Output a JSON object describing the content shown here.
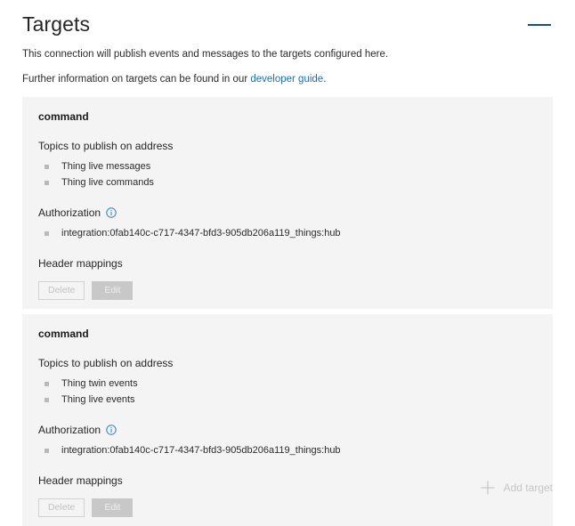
{
  "header": {
    "title": "Targets",
    "collapse_icon": "minus-icon"
  },
  "intro": {
    "line1": "This connection will publish events and messages to the targets configured here.",
    "line2_prefix": "Further information on targets can be found in our ",
    "link_text": "developer guide",
    "line2_suffix": "."
  },
  "labels": {
    "topics": "Topics to publish on address",
    "authorization": "Authorization",
    "header_mappings": "Header mappings",
    "info_icon": "info-icon",
    "delete": "Delete",
    "edit": "Edit"
  },
  "targets": [
    {
      "name": "command",
      "topics": [
        "Thing live messages",
        "Thing live commands"
      ],
      "authorization": [
        "integration:0fab140c-c717-4347-bfd3-905db206a119_things:hub"
      ]
    },
    {
      "name": "command",
      "topics": [
        "Thing twin events",
        "Thing live events"
      ],
      "authorization": [
        "integration:0fab140c-c717-4347-bfd3-905db206a119_things:hub"
      ]
    }
  ],
  "footer": {
    "add_label": "Add target",
    "add_icon": "plus-icon"
  },
  "colors": {
    "accent": "#16527d",
    "link": "#1f6eb5",
    "card_bg": "#f4f4f4",
    "disabled_text": "#c6c6c6"
  }
}
